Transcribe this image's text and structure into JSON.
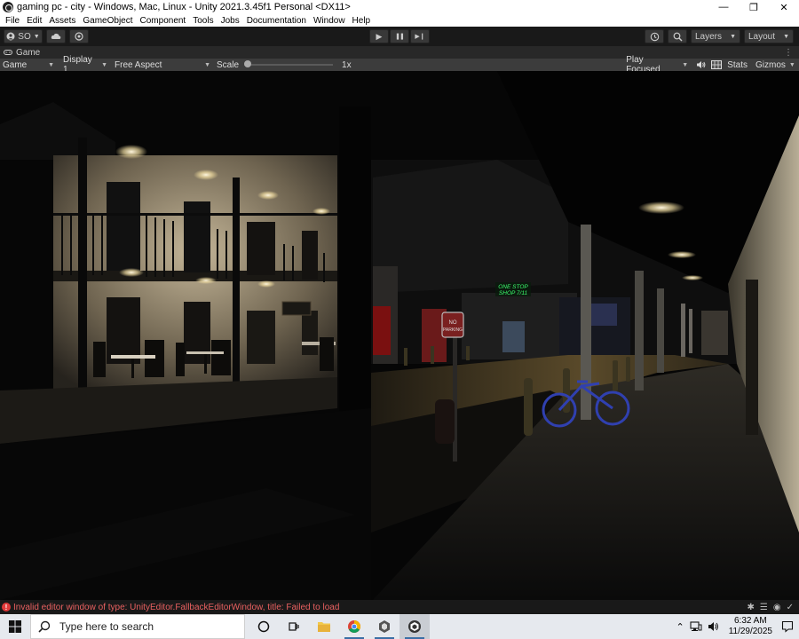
{
  "window": {
    "title": "gaming pc - city - Windows, Mac, Linux - Unity 2021.3.45f1 Personal <DX11>",
    "minimize": "—",
    "restore": "❐",
    "close": "✕"
  },
  "menu": [
    "File",
    "Edit",
    "Assets",
    "GameObject",
    "Component",
    "Tools",
    "Jobs",
    "Documentation",
    "Window",
    "Help"
  ],
  "toolbar": {
    "account_label": "SO",
    "play": "▶",
    "pause": "❚❚",
    "step": "▶❙",
    "layers_label": "Layers",
    "layout_label": "Layout"
  },
  "tab": {
    "label": "Game"
  },
  "gamebar": {
    "view_select": "Game",
    "display_select": "Display 1",
    "aspect_select": "Free Aspect",
    "scale_label": "Scale",
    "scale_value": "1x",
    "scale_fraction": 0,
    "play_mode": "Play Focused",
    "stats_label": "Stats",
    "gizmos_label": "Gizmos"
  },
  "scene_signs": {
    "shop_line1": "ONE STOP",
    "shop_line2": "SHOP 7/11",
    "no_parking_line1": "NO",
    "no_parking_line2": "PARKING"
  },
  "status": {
    "error_message": "Invalid editor window of type: UnityEditor.FallbackEditorWindow, title: Failed to load"
  },
  "taskbar": {
    "search_placeholder": "Type here to search",
    "time": "6:32 AM",
    "date": "11/29/2025"
  },
  "colors": {
    "editor_dark": "#191919",
    "game_bar": "#3c3c3c",
    "error_red": "#e86060",
    "neon_green": "#3cff6e"
  }
}
